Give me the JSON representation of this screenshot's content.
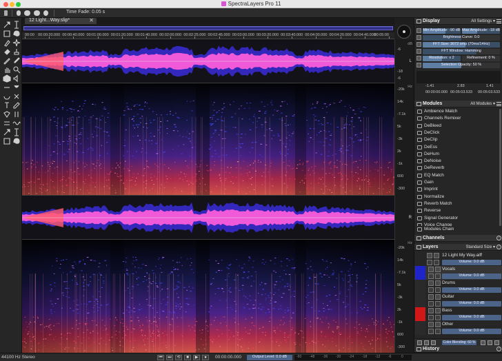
{
  "window": {
    "title": "SpectraLayers Pro 11"
  },
  "toolbar": {
    "time_fade": "Time Fade: 0.05 s"
  },
  "document": {
    "tab_label": "12 Light...Way.slip*",
    "close_glyph": "✕"
  },
  "ruler": {
    "labels": [
      "00:00",
      "00:00:20.000",
      "00:00:40.000",
      "00:01:00.000",
      "00:01:20.000",
      "00:01:40.000",
      "00:02:00.000",
      "00:02:25.000",
      "00:02:45.000",
      "00:03:00.000",
      "00:03:20.000",
      "00:03:40.000",
      "00:04:00.000",
      "00:04:20.000",
      "00:04:40.000",
      "00:05:00"
    ]
  },
  "scales": {
    "wave_top_unit": "dB",
    "wave_ticks": [
      "-6",
      "-18",
      "-6"
    ],
    "channel_left": "L",
    "channel_right": "R",
    "freq_unit": "Hz",
    "freq_ticks": [
      "-20k",
      "14k",
      "-7.1k",
      "5k",
      "-3k",
      "2k",
      "-1k",
      "600",
      "-300"
    ],
    "freq_ticks_2": [
      "-20k",
      "14k",
      "-7.1k",
      "5k",
      "-3k",
      "2k",
      "-1k",
      "600",
      "-300"
    ]
  },
  "display_panel": {
    "title": "Display",
    "dropdown": "All Settings ▾",
    "min_amp": "Min Amplitude: -90 dB",
    "max_amp": "Max Amplitude: -18 dB",
    "brightness": "Brightness Curve: 0.0",
    "fft_size": "FFT Size: 3072 smp (70ms/14Hz)",
    "fft_window": "FFT Window: Hamming",
    "resolution": "Resolution: x 2",
    "refinement": "Refinement: 0 %",
    "selection_opacity": "Selection Opacity: 50 %",
    "num_a": "-1.41",
    "num_b": "2.83",
    "num_c": "1.41",
    "time_a": "00:00:00.000",
    "time_b": "00:05:03.533",
    "time_c": "00:05:03.533"
  },
  "modules_panel": {
    "title": "Modules",
    "dropdown": "All Modules ▾",
    "items": [
      "Ambience Match",
      "Channels Remixer",
      "DeBleed",
      "DeClick",
      "DeClip",
      "DeEss",
      "DeHum",
      "DeNoise",
      "DeReverb",
      "EQ Match",
      "Gain",
      "Imprint",
      "Normalize",
      "Reverb Match",
      "Reverse",
      "Signal Generator",
      "Voice Change"
    ],
    "chain": "Modules Chain"
  },
  "channels_panel": {
    "title": "Channels"
  },
  "layers_panel": {
    "title": "Layers",
    "dropdown": "Standard Size ▾",
    "layers": [
      {
        "name": "12 Light My Way.aiff",
        "volume": "Volume: 0.0 dB",
        "color": "#2a2a2a"
      },
      {
        "name": "Vocals",
        "volume": "Volume: 0.0 dB",
        "color": "#1f24c8"
      },
      {
        "name": "Drums",
        "volume": "Volume: 0.0 dB",
        "color": "#2a2a2a"
      },
      {
        "name": "Guitar",
        "volume": "Volume: 0.0 dB",
        "color": "#2a2a2a"
      },
      {
        "name": "Bass",
        "volume": "Volume: 0.0 dB",
        "color": "#d01818"
      },
      {
        "name": "Other",
        "volume": "Volume: 0.0 dB",
        "color": "#2a2a2a"
      }
    ],
    "color_blending": "Color Blending: 60 %"
  },
  "history_panel": {
    "title": "History"
  },
  "status": {
    "format": "44100 Hz Stereo",
    "time": "00:00:00.000",
    "output_level": "Output Level: 0.0 dB",
    "meter_ticks": [
      "-60",
      "-48",
      "-36",
      "-30",
      "-24",
      "-18",
      "-12",
      "-6",
      "0"
    ]
  },
  "colors": {
    "accent": "#5e7ea4",
    "vocals": "#1f24c8",
    "bass": "#d01818",
    "spectrum_hot": "#ff4a5a",
    "spectrum_cool": "#4040ff"
  }
}
